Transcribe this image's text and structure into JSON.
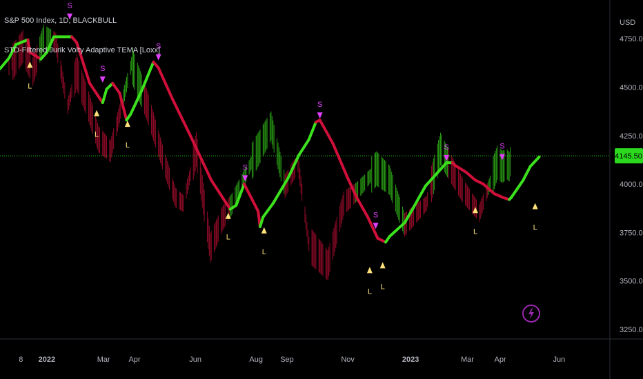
{
  "header": {
    "line1": "S&P 500 Index, 1D, BLACKBULL",
    "line2": "STD-Filtered Jurik Volty Adaptive TEMA [Loxx]"
  },
  "colors": {
    "background": "#000000",
    "up": "#3ce11e",
    "down": "#d0103a",
    "long_marker": "#ffe27a",
    "short_marker": "#e040fb",
    "axis_text": "#b2b5be",
    "price_label_bg": "#2bd81e",
    "price_line": "#2bd81e"
  },
  "chart_data": {
    "type": "line",
    "title": "S&P 500 Index, 1D, BLACKBULL",
    "indicator": "STD-Filtered Jurik Volty Adaptive TEMA [Loxx]",
    "y_axis": {
      "unit": "USD",
      "ylim": [
        3200,
        4950
      ],
      "ticks": [
        "4750.00",
        "4500.00",
        "4250.00",
        "4000.00",
        "3750.00",
        "3500.00",
        "3250.00"
      ],
      "position": "right"
    },
    "x_axis": {
      "xlim": [
        "2021-11-17",
        "2023-07-22"
      ],
      "ticks": [
        {
          "label": "8",
          "date": "2021-12-08",
          "bold": false
        },
        {
          "label": "2022",
          "date": "2022-01-03",
          "bold": true
        },
        {
          "label": "Mar",
          "date": "2022-03-01",
          "bold": false
        },
        {
          "label": "Apr",
          "date": "2022-04-01",
          "bold": false
        },
        {
          "label": "Jun",
          "date": "2022-06-01",
          "bold": false
        },
        {
          "label": "Aug",
          "date": "2022-08-01",
          "bold": false
        },
        {
          "label": "Sep",
          "date": "2022-09-01",
          "bold": false
        },
        {
          "label": "Nov",
          "date": "2022-11-01",
          "bold": false
        },
        {
          "label": "2023",
          "date": "2023-01-03",
          "bold": true
        },
        {
          "label": "Mar",
          "date": "2023-03-01",
          "bold": false
        },
        {
          "label": "Apr",
          "date": "2023-04-03",
          "bold": false
        },
        {
          "label": "Jun",
          "date": "2023-06-01",
          "bold": false
        }
      ]
    },
    "last_price": 4145.5,
    "last_price_label": "4145.50",
    "series": [
      {
        "role": "adaptive-tema",
        "points": [
          {
            "x": "2021-11-17",
            "y": 4595,
            "c": "up"
          },
          {
            "x": "2021-11-26",
            "y": 4650,
            "c": "up"
          },
          {
            "x": "2021-12-03",
            "y": 4720,
            "c": "up"
          },
          {
            "x": "2021-12-15",
            "y": 4745,
            "c": "up"
          },
          {
            "x": "2021-12-17",
            "y": 4680,
            "c": "down"
          },
          {
            "x": "2021-12-28",
            "y": 4645,
            "c": "down"
          },
          {
            "x": "2022-01-03",
            "y": 4680,
            "c": "up"
          },
          {
            "x": "2022-01-10",
            "y": 4760,
            "c": "up"
          },
          {
            "x": "2022-01-28",
            "y": 4760,
            "c": "up"
          },
          {
            "x": "2022-02-02",
            "y": 4730,
            "c": "down"
          },
          {
            "x": "2022-02-15",
            "y": 4520,
            "c": "down"
          },
          {
            "x": "2022-02-28",
            "y": 4420,
            "c": "down"
          },
          {
            "x": "2022-03-04",
            "y": 4490,
            "c": "up"
          },
          {
            "x": "2022-03-10",
            "y": 4520,
            "c": "up"
          },
          {
            "x": "2022-03-17",
            "y": 4470,
            "c": "down"
          },
          {
            "x": "2022-03-24",
            "y": 4330,
            "c": "down"
          },
          {
            "x": "2022-03-28",
            "y": 4360,
            "c": "up"
          },
          {
            "x": "2022-04-08",
            "y": 4480,
            "c": "up"
          },
          {
            "x": "2022-04-20",
            "y": 4630,
            "c": "up"
          },
          {
            "x": "2022-04-25",
            "y": 4600,
            "c": "down"
          },
          {
            "x": "2022-05-09",
            "y": 4440,
            "c": "down"
          },
          {
            "x": "2022-05-27",
            "y": 4250,
            "c": "down"
          },
          {
            "x": "2022-06-17",
            "y": 4020,
            "c": "down"
          },
          {
            "x": "2022-07-06",
            "y": 3870,
            "c": "down"
          },
          {
            "x": "2022-07-12",
            "y": 3890,
            "c": "up"
          },
          {
            "x": "2022-07-20",
            "y": 4000,
            "c": "up"
          },
          {
            "x": "2022-07-22",
            "y": 3980,
            "c": "down"
          },
          {
            "x": "2022-08-03",
            "y": 3860,
            "c": "down"
          },
          {
            "x": "2022-08-05",
            "y": 3780,
            "c": "down"
          },
          {
            "x": "2022-08-08",
            "y": 3830,
            "c": "up"
          },
          {
            "x": "2022-08-18",
            "y": 3900,
            "c": "up"
          },
          {
            "x": "2022-09-02",
            "y": 4030,
            "c": "up"
          },
          {
            "x": "2022-09-13",
            "y": 4150,
            "c": "up"
          },
          {
            "x": "2022-09-23",
            "y": 4230,
            "c": "up"
          },
          {
            "x": "2022-09-30",
            "y": 4320,
            "c": "up"
          },
          {
            "x": "2022-10-04",
            "y": 4330,
            "c": "down"
          },
          {
            "x": "2022-10-17",
            "y": 4210,
            "c": "down"
          },
          {
            "x": "2022-11-01",
            "y": 4030,
            "c": "down"
          },
          {
            "x": "2022-11-10",
            "y": 3930,
            "c": "down"
          },
          {
            "x": "2022-11-21",
            "y": 3830,
            "c": "down"
          },
          {
            "x": "2022-12-01",
            "y": 3720,
            "c": "down"
          },
          {
            "x": "2022-12-09",
            "y": 3700,
            "c": "down"
          },
          {
            "x": "2022-12-13",
            "y": 3730,
            "c": "up"
          },
          {
            "x": "2022-12-28",
            "y": 3800,
            "c": "up"
          },
          {
            "x": "2023-01-06",
            "y": 3880,
            "c": "up"
          },
          {
            "x": "2023-01-18",
            "y": 3990,
            "c": "up"
          },
          {
            "x": "2023-02-01",
            "y": 4070,
            "c": "up"
          },
          {
            "x": "2023-02-08",
            "y": 4110,
            "c": "up"
          },
          {
            "x": "2023-02-14",
            "y": 4110,
            "c": "up"
          },
          {
            "x": "2023-02-17",
            "y": 4095,
            "c": "down"
          },
          {
            "x": "2023-02-28",
            "y": 4060,
            "c": "down"
          },
          {
            "x": "2023-03-09",
            "y": 4020,
            "c": "down"
          },
          {
            "x": "2023-03-17",
            "y": 4000,
            "c": "down"
          },
          {
            "x": "2023-03-28",
            "y": 3950,
            "c": "down"
          },
          {
            "x": "2023-04-06",
            "y": 3930,
            "c": "down"
          },
          {
            "x": "2023-04-12",
            "y": 3920,
            "c": "down"
          },
          {
            "x": "2023-04-14",
            "y": 3930,
            "c": "up"
          },
          {
            "x": "2023-04-20",
            "y": 3975,
            "c": "up"
          },
          {
            "x": "2023-04-26",
            "y": 4020,
            "c": "up"
          },
          {
            "x": "2023-05-03",
            "y": 4090,
            "c": "up"
          },
          {
            "x": "2023-05-12",
            "y": 4140,
            "c": "up"
          }
        ]
      },
      {
        "role": "price-bars",
        "points": [
          {
            "x": "2021-11-26",
            "y": 4600
          },
          {
            "x": "2021-12-10",
            "y": 4710
          },
          {
            "x": "2021-12-20",
            "y": 4580
          },
          {
            "x": "2021-12-31",
            "y": 4760
          },
          {
            "x": "2022-01-12",
            "y": 4730
          },
          {
            "x": "2022-01-24",
            "y": 4400
          },
          {
            "x": "2022-02-02",
            "y": 4580
          },
          {
            "x": "2022-02-14",
            "y": 4400
          },
          {
            "x": "2022-02-24",
            "y": 4230
          },
          {
            "x": "2022-03-08",
            "y": 4170
          },
          {
            "x": "2022-03-29",
            "y": 4620
          },
          {
            "x": "2022-04-14",
            "y": 4400
          },
          {
            "x": "2022-04-29",
            "y": 4140
          },
          {
            "x": "2022-05-12",
            "y": 3930
          },
          {
            "x": "2022-05-20",
            "y": 3900
          },
          {
            "x": "2022-06-02",
            "y": 4180
          },
          {
            "x": "2022-06-16",
            "y": 3670
          },
          {
            "x": "2022-06-28",
            "y": 3820
          },
          {
            "x": "2022-07-08",
            "y": 3900
          },
          {
            "x": "2022-07-29",
            "y": 4130
          },
          {
            "x": "2022-08-16",
            "y": 4300
          },
          {
            "x": "2022-08-30",
            "y": 3990
          },
          {
            "x": "2022-09-12",
            "y": 4110
          },
          {
            "x": "2022-09-23",
            "y": 3690
          },
          {
            "x": "2022-10-12",
            "y": 3580
          },
          {
            "x": "2022-10-28",
            "y": 3900
          },
          {
            "x": "2022-11-10",
            "y": 3960
          },
          {
            "x": "2022-11-30",
            "y": 4080
          },
          {
            "x": "2022-12-13",
            "y": 4020
          },
          {
            "x": "2022-12-28",
            "y": 3790
          },
          {
            "x": "2023-01-19",
            "y": 3900
          },
          {
            "x": "2023-02-02",
            "y": 4180
          },
          {
            "x": "2023-02-24",
            "y": 3970
          },
          {
            "x": "2023-03-13",
            "y": 3850
          },
          {
            "x": "2023-03-31",
            "y": 4110
          },
          {
            "x": "2023-04-05",
            "y": 4090
          },
          {
            "x": "2023-04-10",
            "y": 4100
          },
          {
            "x": "2023-04-12",
            "y": 4090
          },
          {
            "x": "2023-04-14",
            "y": 4140
          }
        ]
      }
    ],
    "signals": [
      {
        "type": "L",
        "x": "2021-12-17",
        "y": 4600
      },
      {
        "type": "S",
        "x": "2022-01-26",
        "y": 4880
      },
      {
        "type": "L",
        "x": "2022-02-22",
        "y": 4350
      },
      {
        "type": "S",
        "x": "2022-02-28",
        "y": 4555
      },
      {
        "type": "L",
        "x": "2022-03-25",
        "y": 4295
      },
      {
        "type": "S",
        "x": "2022-04-25",
        "y": 4670
      },
      {
        "type": "L",
        "x": "2022-07-04",
        "y": 3820
      },
      {
        "type": "S",
        "x": "2022-07-21",
        "y": 4045
      },
      {
        "type": "L",
        "x": "2022-08-09",
        "y": 3745
      },
      {
        "type": "S",
        "x": "2022-10-04",
        "y": 4370
      },
      {
        "type": "S",
        "x": "2022-11-29",
        "y": 3800
      },
      {
        "type": "L",
        "x": "2022-11-23",
        "y": 3540
      },
      {
        "type": "L",
        "x": "2022-12-06",
        "y": 3565
      },
      {
        "type": "S",
        "x": "2023-02-08",
        "y": 4150
      },
      {
        "type": "L",
        "x": "2023-03-09",
        "y": 3850
      },
      {
        "type": "S",
        "x": "2023-04-05",
        "y": 4155
      },
      {
        "type": "L",
        "x": "2023-05-08",
        "y": 3870
      }
    ]
  }
}
